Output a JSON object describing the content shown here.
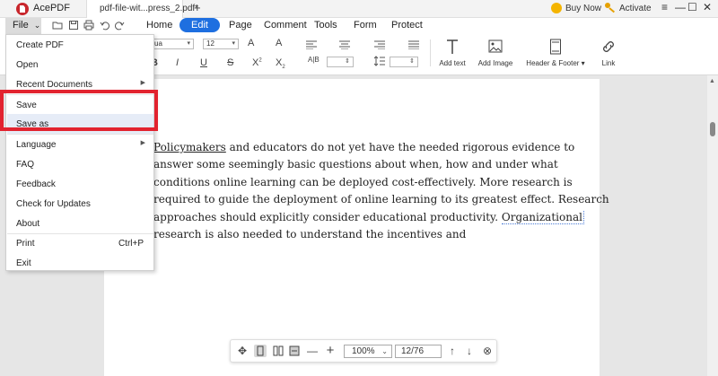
{
  "app": {
    "name": "AcePDF",
    "doc_tab": "pdf-file-wit...press_2.pdf*",
    "new_tab": "+",
    "buy_now": "Buy Now",
    "activate": "Activate",
    "window_controls": [
      "≡",
      "—",
      "☐",
      "✕"
    ]
  },
  "tabs": {
    "file": "File",
    "file_arrow": "⌄",
    "items": [
      "Home",
      "Edit",
      "Page",
      "Comment",
      "Tools",
      "Form",
      "Protect"
    ],
    "active": "Edit"
  },
  "toolbar": {
    "font_family": "ua",
    "font_size": "12",
    "format_glyphs": [
      "A",
      "A",
      "B",
      "I",
      "U",
      "S",
      "X",
      "X"
    ],
    "char_spacing_glyph": "A|B",
    "tools": [
      {
        "label": "Add text",
        "icon": "add-text-icon"
      },
      {
        "label": "Add Image",
        "icon": "add-image-icon"
      },
      {
        "label": "Header & Footer",
        "icon": "header-footer-icon"
      },
      {
        "label": "Link",
        "icon": "link-icon"
      }
    ],
    "header_footer_arrow": "▾"
  },
  "file_menu": {
    "items": [
      {
        "label": "Create PDF"
      },
      {
        "label": "Open"
      },
      {
        "label": "Recent Documents",
        "submenu": true
      },
      {
        "label": "Save"
      },
      {
        "label": "Save as",
        "highlighted": true
      },
      {
        "label": "Language",
        "submenu": true
      },
      {
        "label": "FAQ"
      },
      {
        "label": "Feedback"
      },
      {
        "label": "Check for Updates"
      },
      {
        "label": "About"
      },
      {
        "label": "Print",
        "shortcut": "Ctrl+P"
      },
      {
        "label": "Exit"
      }
    ],
    "submenu_arrow": "▶"
  },
  "document": {
    "lines": [
      [
        "Policymakers",
        " and educators do not yet have the needed rigorous evidence to"
      ],
      [
        "answer some seemingly basic questions about when, how and under what"
      ],
      [
        "conditions online learning can be deployed cost-effectively. More research is"
      ],
      [
        "required to guide the deployment of online learning to its greatest effect. Research"
      ],
      [
        "approaches should explicitly consider educational productivity. ",
        "Organizational"
      ],
      [
        "research is also needed to understand the incentives and"
      ]
    ]
  },
  "navbar": {
    "zoom": "100%",
    "zoom_arrow": "⌄",
    "page": "12/76"
  },
  "colors": {
    "accent": "#1e6fe0",
    "highlight_box": "#e2232f"
  }
}
